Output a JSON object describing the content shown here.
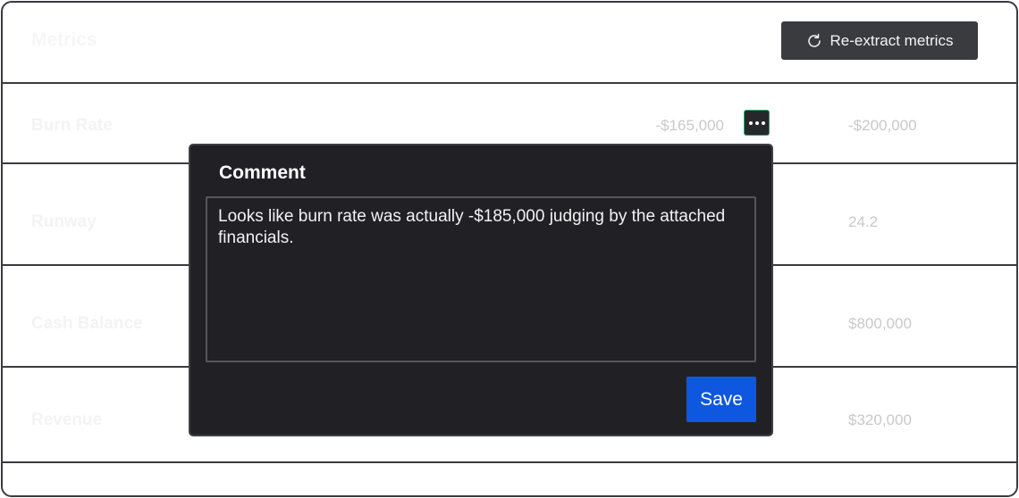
{
  "metrics": {
    "title": "Metrics",
    "reextract_label": "Re-extract metrics",
    "rows": [
      {
        "label": "Burn Rate",
        "value_a": "-$165,000",
        "value_b": "-$200,000"
      },
      {
        "label": "Runway",
        "value_b": "24.2"
      },
      {
        "label": "Cash Balance",
        "value_b": "$800,000"
      },
      {
        "label": "Revenue",
        "value_b": "$320,000"
      }
    ]
  },
  "comment_popover": {
    "title": "Comment",
    "text": "Looks like burn rate was actually -$185,000 judging by the attached financials.",
    "save_label": "Save"
  },
  "icons": {
    "reextract": "refresh-icon",
    "more": "more-horizontal-icon"
  },
  "colors": {
    "popover_bg": "#212125",
    "save_button": "#0e58e0",
    "border": "#3b3b3f"
  }
}
